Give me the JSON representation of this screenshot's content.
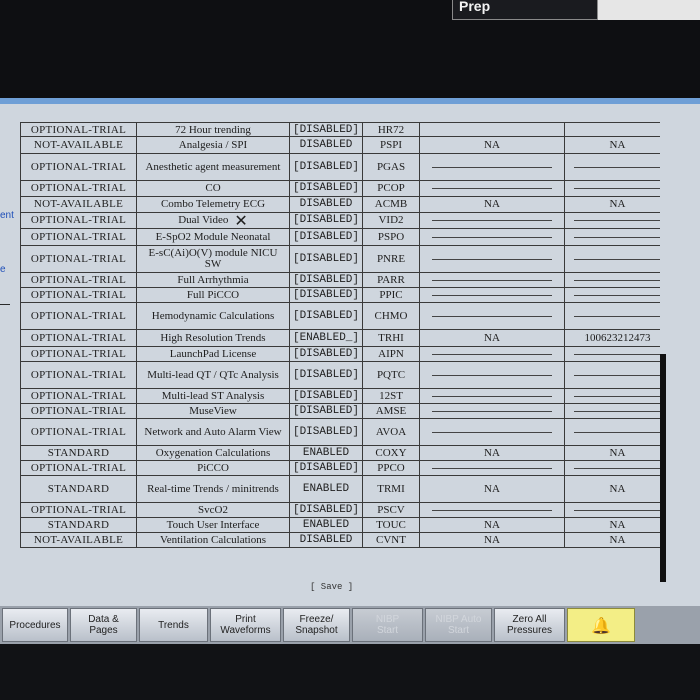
{
  "header": {
    "mode_label": "Prep"
  },
  "sidebar": {
    "fragments": [
      "ent",
      "e"
    ]
  },
  "options_table": {
    "partial_first_row": {
      "status": "OPTIONAL-TRIAL",
      "feature": "72 Hour trending",
      "enabled": "[DISABLED]",
      "code": "HR72"
    },
    "rows": [
      {
        "status": "NOT-AVAILABLE",
        "feature": "Analgesia / SPI",
        "enabled": "DISABLED",
        "code": "PSPI",
        "value_a": "NA",
        "value_b": "NA"
      },
      {
        "status": "OPTIONAL-TRIAL",
        "feature": "Anesthetic agent measurement",
        "enabled": "[DISABLED]",
        "code": "PGAS",
        "value_a": "",
        "value_b": ""
      },
      {
        "status": "OPTIONAL-TRIAL",
        "feature": "CO",
        "enabled": "[DISABLED]",
        "code": "PCOP",
        "value_a": "",
        "value_b": ""
      },
      {
        "status": "NOT-AVAILABLE",
        "feature": "Combo Telemetry ECG",
        "enabled": "DISABLED",
        "code": "ACMB",
        "value_a": "NA",
        "value_b": "NA"
      },
      {
        "status": "OPTIONAL-TRIAL",
        "feature": "Dual Video",
        "enabled": "[DISABLED]",
        "code": "VID2",
        "value_a": "",
        "value_b": ""
      },
      {
        "status": "OPTIONAL-TRIAL",
        "feature": "E-SpO2 Module Neonatal",
        "enabled": "[DISABLED]",
        "code": "PSPO",
        "value_a": "",
        "value_b": ""
      },
      {
        "status": "OPTIONAL-TRIAL",
        "feature": "E-sC(Ai)O(V) module NICU SW",
        "enabled": "[DISABLED]",
        "code": "PNRE",
        "value_a": "",
        "value_b": ""
      },
      {
        "status": "OPTIONAL-TRIAL",
        "feature": "Full Arrhythmia",
        "enabled": "[DISABLED]",
        "code": "PARR",
        "value_a": "",
        "value_b": ""
      },
      {
        "status": "OPTIONAL-TRIAL",
        "feature": "Full PiCCO",
        "enabled": "[DISABLED]",
        "code": "PPIC",
        "value_a": "",
        "value_b": ""
      },
      {
        "status": "OPTIONAL-TRIAL",
        "feature": "Hemodynamic Calculations",
        "enabled": "[DISABLED]",
        "code": "CHMO",
        "value_a": "",
        "value_b": ""
      },
      {
        "status": "OPTIONAL-TRIAL",
        "feature": "High Resolution Trends",
        "enabled": "[ENABLED_]",
        "code": "TRHI",
        "value_a": "NA",
        "value_b": "100623212473"
      },
      {
        "status": "OPTIONAL-TRIAL",
        "feature": "LaunchPad License",
        "enabled": "[DISABLED]",
        "code": "AIPN",
        "value_a": "",
        "value_b": ""
      },
      {
        "status": "OPTIONAL-TRIAL",
        "feature": "Multi-lead QT / QTc Analysis",
        "enabled": "[DISABLED]",
        "code": "PQTC",
        "value_a": "",
        "value_b": ""
      },
      {
        "status": "OPTIONAL-TRIAL",
        "feature": "Multi-lead ST Analysis",
        "enabled": "[DISABLED]",
        "code": "12ST",
        "value_a": "",
        "value_b": ""
      },
      {
        "status": "OPTIONAL-TRIAL",
        "feature": "MuseView",
        "enabled": "[DISABLED]",
        "code": "AMSE",
        "value_a": "",
        "value_b": ""
      },
      {
        "status": "OPTIONAL-TRIAL",
        "feature": "Network and Auto Alarm View",
        "enabled": "[DISABLED]",
        "code": "AVOA",
        "value_a": "",
        "value_b": ""
      },
      {
        "status": "STANDARD",
        "feature": "Oxygenation Calculations",
        "enabled": "ENABLED",
        "code": "COXY",
        "value_a": "NA",
        "value_b": "NA"
      },
      {
        "status": "OPTIONAL-TRIAL",
        "feature": "PiCCO",
        "enabled": "[DISABLED]",
        "code": "PPCO",
        "value_a": "",
        "value_b": ""
      },
      {
        "status": "STANDARD",
        "feature": "Real-time Trends / minitrends",
        "enabled": "ENABLED",
        "code": "TRMI",
        "value_a": "NA",
        "value_b": "NA"
      },
      {
        "status": "OPTIONAL-TRIAL",
        "feature": "SvcO2",
        "enabled": "[DISABLED]",
        "code": "PSCV",
        "value_a": "",
        "value_b": ""
      },
      {
        "status": "STANDARD",
        "feature": "Touch User Interface",
        "enabled": "ENABLED",
        "code": "TOUC",
        "value_a": "NA",
        "value_b": "NA"
      },
      {
        "status": "NOT-AVAILABLE",
        "feature": "Ventilation Calculations",
        "enabled": "DISABLED",
        "code": "CVNT",
        "value_a": "NA",
        "value_b": "NA"
      }
    ]
  },
  "save_label": "[ Save ]",
  "softkeys": [
    {
      "name": "procedures-button",
      "label": "Procedures",
      "enabled": true
    },
    {
      "name": "data-and-pages-button",
      "label": "Data &\nPages",
      "enabled": true
    },
    {
      "name": "trends-button",
      "label": "Trends",
      "enabled": true
    },
    {
      "name": "print-waveforms-button",
      "label": "Print\nWaveforms",
      "enabled": true
    },
    {
      "name": "freeze-snapshot-button",
      "label": "Freeze/\nSnapshot",
      "enabled": true
    },
    {
      "name": "nibp-start-button",
      "label": "NIBP\nStart",
      "enabled": false
    },
    {
      "name": "nibp-auto-start-button",
      "label": "NIBP Auto\nStart",
      "enabled": false
    },
    {
      "name": "zero-all-pressures-button",
      "label": "Zero All\nPressures",
      "enabled": true
    },
    {
      "name": "alarm-silence-button",
      "label": "",
      "icon": "bell-icon",
      "enabled": true
    }
  ],
  "colors": {
    "title_bar": "#6f9fd6",
    "screen_bg": "#cfd6de",
    "alarm_key": "#f3ee86"
  }
}
